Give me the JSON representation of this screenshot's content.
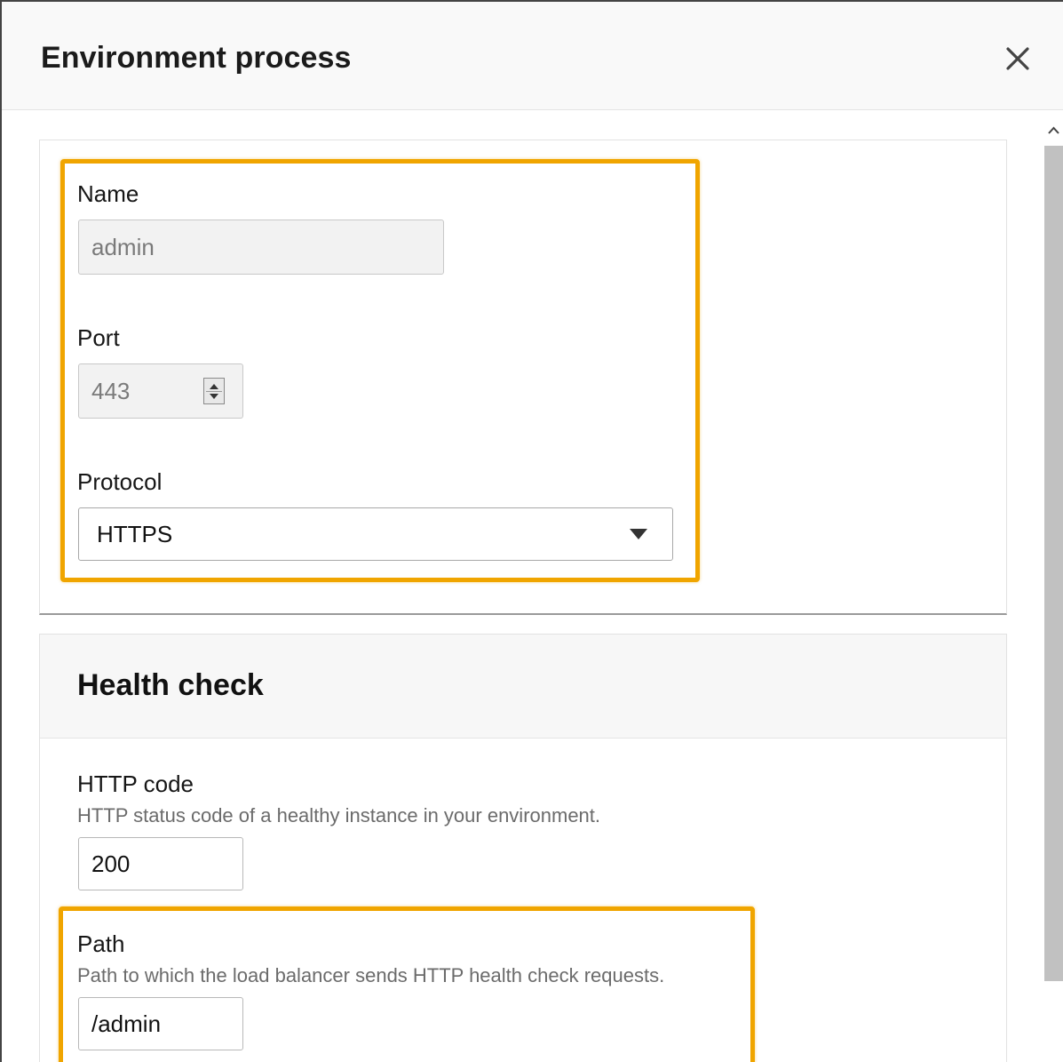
{
  "modal": {
    "title": "Environment process",
    "close_icon": "close-icon"
  },
  "process": {
    "name": {
      "label": "Name",
      "value": "admin"
    },
    "port": {
      "label": "Port",
      "value": "443"
    },
    "protocol": {
      "label": "Protocol",
      "selected": "HTTPS"
    }
  },
  "health_check": {
    "title": "Health check",
    "http_code": {
      "label": "HTTP code",
      "description": "HTTP status code of a healthy instance in your environment.",
      "value": "200"
    },
    "path": {
      "label": "Path",
      "description": "Path to which the load balancer sends HTTP health check requests.",
      "value": "/admin"
    }
  },
  "colors": {
    "highlight": "#f0a500",
    "scrollbar_thumb": "#c1c1c1"
  },
  "icons": {
    "close": "close-icon",
    "dropdown": "caret-down-icon",
    "stepper": "spinner-arrows-icon",
    "scroll_up": "chevron-up-icon"
  }
}
